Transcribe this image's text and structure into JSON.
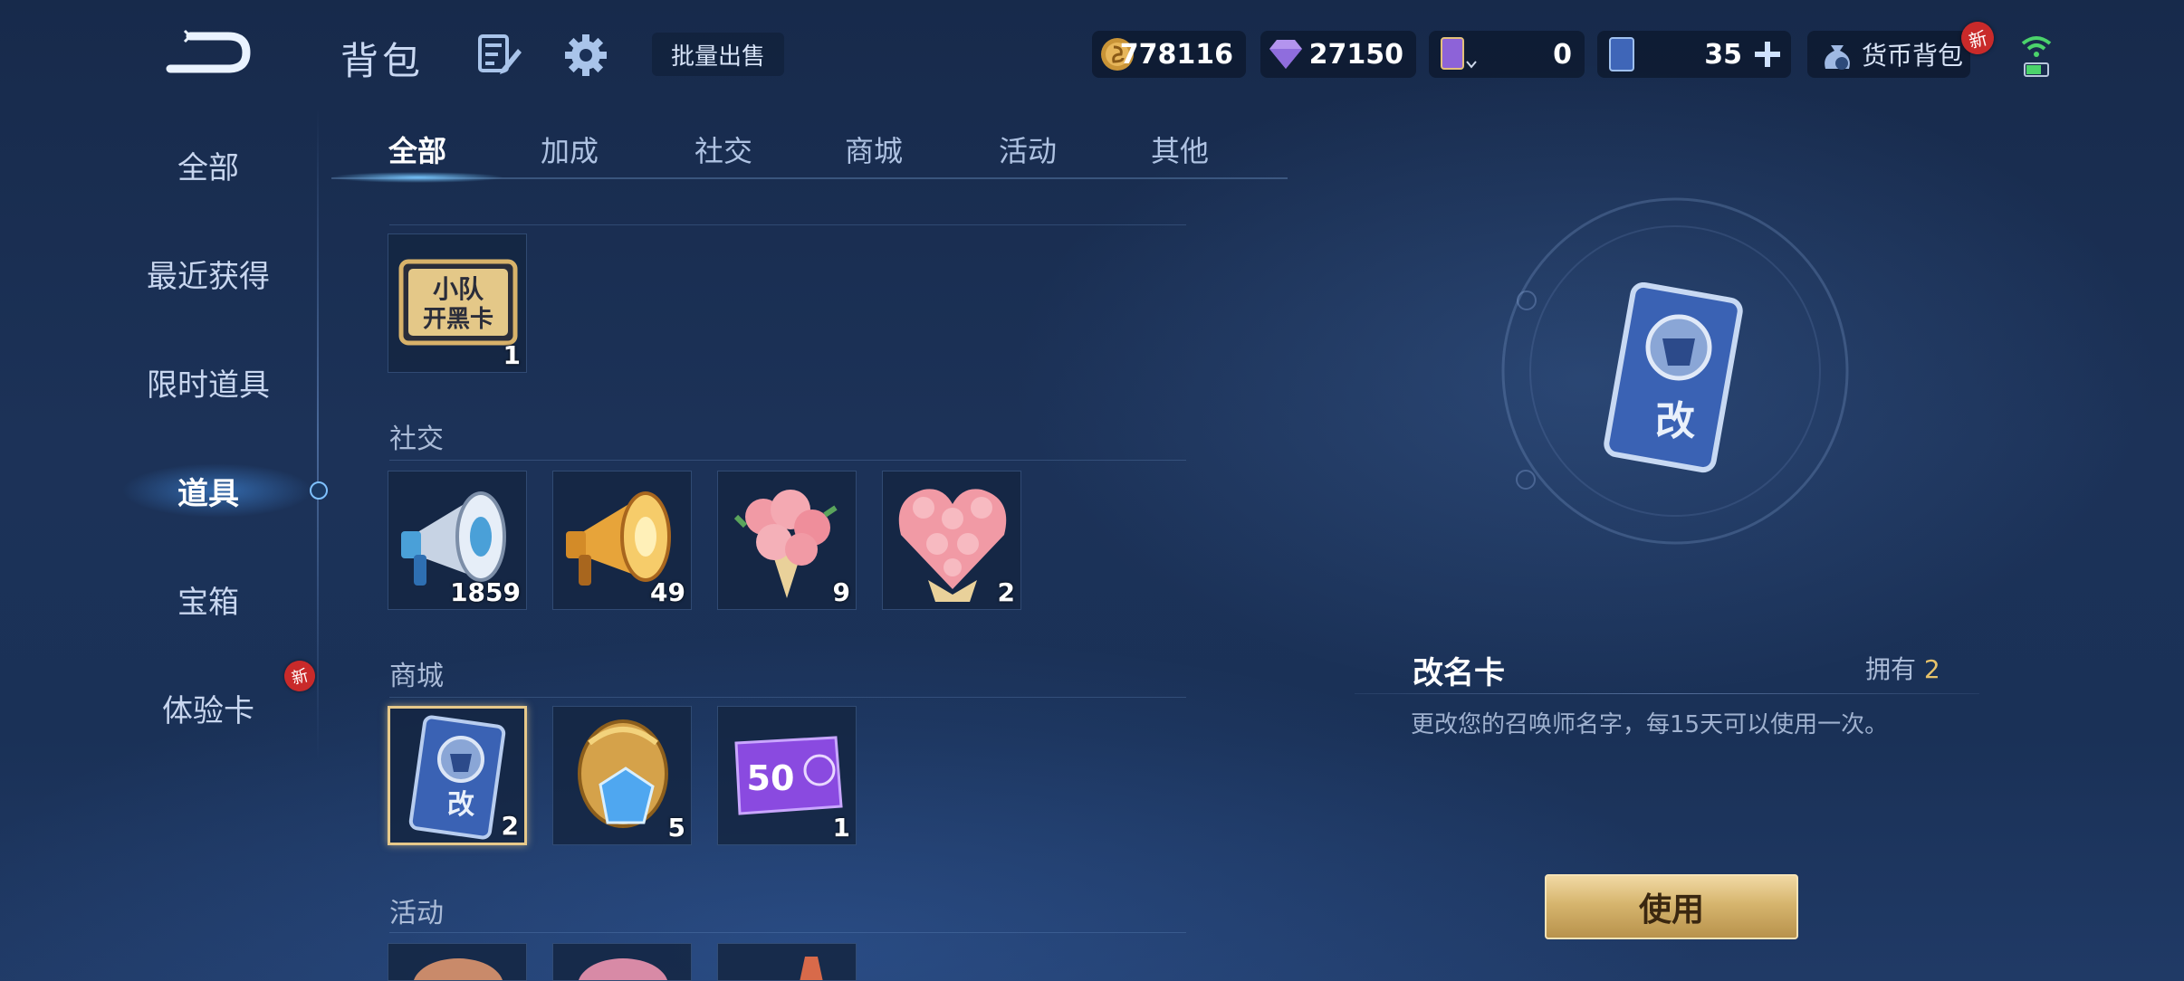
{
  "header": {
    "title": "背包",
    "batch_sell": "批量出售",
    "currencies": [
      {
        "name": "gold-coin-icon",
        "value": "778116"
      },
      {
        "name": "diamond-icon",
        "value": "27150"
      },
      {
        "name": "hero-card-icon",
        "value": "0"
      },
      {
        "name": "rename-card-icon",
        "value": "35"
      }
    ],
    "currency_wallet": "货币背包",
    "new_badge": "新"
  },
  "sidebar": {
    "items": [
      {
        "label": "全部"
      },
      {
        "label": "最近获得"
      },
      {
        "label": "限时道具"
      },
      {
        "label": "道具"
      },
      {
        "label": "宝箱"
      },
      {
        "label": "体验卡"
      }
    ],
    "active": "道具",
    "new_badge": "新"
  },
  "tabs": [
    {
      "label": "全部"
    },
    {
      "label": "加成"
    },
    {
      "label": "社交"
    },
    {
      "label": "商城"
    },
    {
      "label": "活动"
    },
    {
      "label": "其他"
    }
  ],
  "sections": {
    "top": {
      "items": [
        {
          "icon": "squad-card-icon",
          "text": "小队 开黑卡",
          "count": "1"
        }
      ]
    },
    "social": {
      "label": "社交",
      "items": [
        {
          "icon": "silver-megaphone-icon",
          "count": "1859"
        },
        {
          "icon": "gold-megaphone-icon",
          "count": "49"
        },
        {
          "icon": "rose-bouquet-icon",
          "count": "9"
        },
        {
          "icon": "rose-heart-icon",
          "count": "2"
        }
      ]
    },
    "mall": {
      "label": "商城",
      "items": [
        {
          "icon": "rename-card-icon",
          "text": "改",
          "count": "2"
        },
        {
          "icon": "gold-gem-egg-icon",
          "count": "5"
        },
        {
          "icon": "voucher-50-icon",
          "text": "50",
          "count": "1"
        }
      ]
    },
    "activity": {
      "label": "活动"
    }
  },
  "detail": {
    "name": "改名卡",
    "owned_label": "拥有",
    "owned_count": "2",
    "description": "更改您的召唤师名字，每15天可以使用一次。",
    "card_char": "改",
    "use_button": "使用"
  },
  "colors": {
    "accent_gold": "#e8c36a",
    "background": "#1c3258",
    "selected_border": "#e7c98a"
  }
}
